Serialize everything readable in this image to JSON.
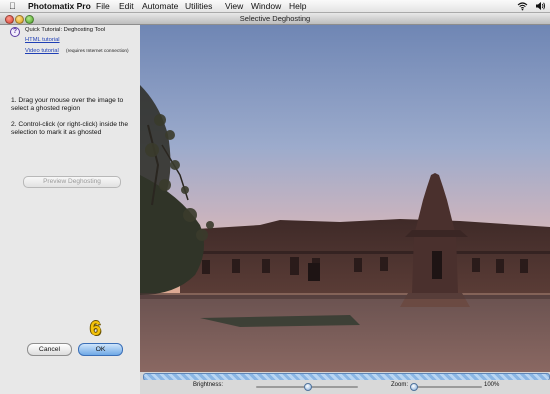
{
  "menubar": {
    "apple_icon": "apple-icon",
    "app_name": "Photomatix Pro",
    "items": [
      "File",
      "Edit",
      "Automate",
      "Utilities",
      "View",
      "Window",
      "Help"
    ],
    "status_icons": [
      "wifi-icon",
      "volume-icon"
    ]
  },
  "window": {
    "title": "Selective Deghosting",
    "controls": [
      "close",
      "minimize",
      "zoom"
    ]
  },
  "tutorial": {
    "icon": "help-icon",
    "title": "Quick Tutorial: Deghosting Tool",
    "html_link": "HTML tutorial",
    "video_link": "Video tutorial",
    "video_note": "(requires Internet connection)"
  },
  "instructions": {
    "step1": "1. Drag your mouse over the image to select a ghosted region",
    "step2": "2. Control-click (or right-click) inside the selection to mark it as ghosted"
  },
  "buttons": {
    "preview": "Preview Deghosting",
    "cancel": "Cancel",
    "ok": "OK"
  },
  "annotation": {
    "step_number": "6",
    "color": "#f4c20a"
  },
  "image": {
    "subject": "Khmer temple at dusk with tree silhouette"
  },
  "controls": {
    "brightness_label": "Brightness:",
    "brightness_level": 0.5,
    "zoom_label": "Zoom:",
    "zoom_value": "100%"
  },
  "colors": {
    "accent": "#6fa9e6",
    "link": "#1f3fb5",
    "progress": "#8ab6e4"
  }
}
